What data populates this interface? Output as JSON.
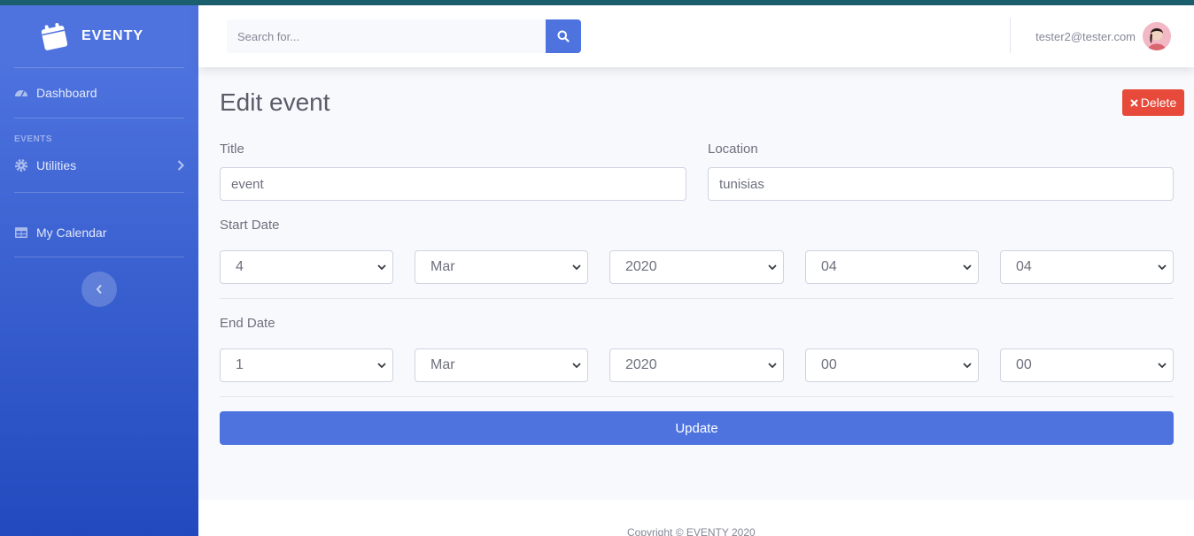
{
  "brand": {
    "name": "EVENTY"
  },
  "sidebar": {
    "dashboard_label": "Dashboard",
    "heading": "EVENTS",
    "utilities_label": "Utilities",
    "calendar_label": "My Calendar"
  },
  "topbar": {
    "search_placeholder": "Search for...",
    "user_email": "tester2@tester.com"
  },
  "page": {
    "title": "Edit event",
    "delete_label": "Delete"
  },
  "form": {
    "title_label": "Title",
    "title_value": "event",
    "location_label": "Location",
    "location_value": "tunisias",
    "start_label": "Start Date",
    "start": {
      "day": "4",
      "month": "Mar",
      "year": "2020",
      "hour": "04",
      "minute": "04"
    },
    "end_label": "End Date",
    "end": {
      "day": "1",
      "month": "Mar",
      "year": "2020",
      "hour": "00",
      "minute": "00"
    },
    "update_label": "Update"
  },
  "footer": {
    "copyright": "Copyright © EVENTY 2020"
  },
  "colors": {
    "primary": "#4e73df",
    "danger": "#e74a3b",
    "sidebar_dark": "#224abe"
  }
}
